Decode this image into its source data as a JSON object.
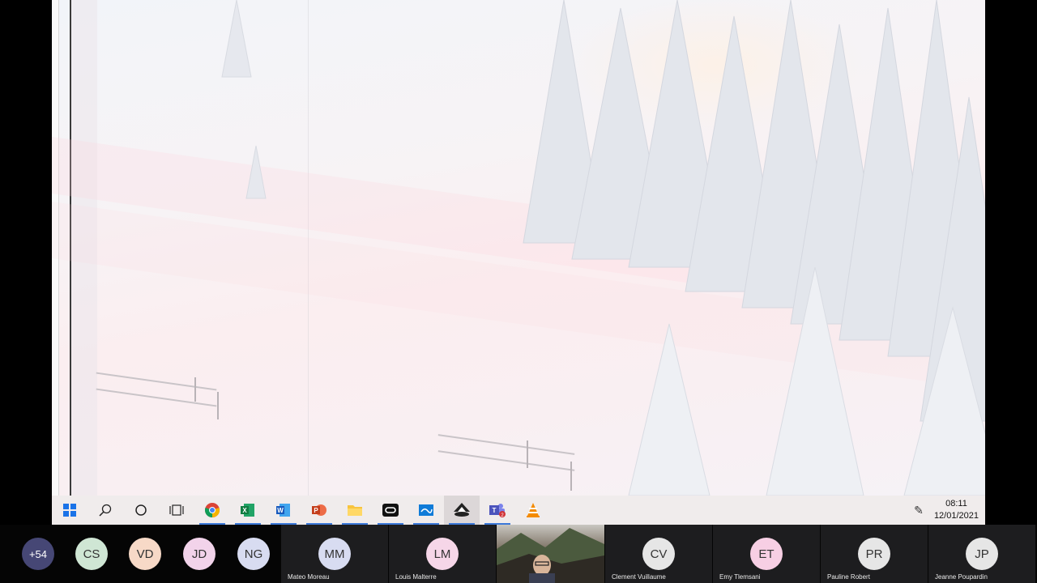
{
  "taskbar": {
    "apps": [
      {
        "name": "start-button",
        "icon": "windows-icon"
      },
      {
        "name": "search-button",
        "icon": "search-icon"
      },
      {
        "name": "cortana-button",
        "icon": "circle-icon"
      },
      {
        "name": "task-view-button",
        "icon": "task-view-icon"
      },
      {
        "name": "chrome-button",
        "icon": "chrome-icon"
      },
      {
        "name": "excel-button",
        "icon": "excel-icon"
      },
      {
        "name": "word-button",
        "icon": "word-icon"
      },
      {
        "name": "powerpoint-button",
        "icon": "powerpoint-icon"
      },
      {
        "name": "file-explorer-button",
        "icon": "folder-icon"
      },
      {
        "name": "oculus-button",
        "icon": "oculus-icon"
      },
      {
        "name": "whiteboard-button",
        "icon": "whiteboard-icon"
      },
      {
        "name": "inkscape-button",
        "icon": "inkscape-icon"
      },
      {
        "name": "teams-button",
        "icon": "teams-icon",
        "badge": "2"
      },
      {
        "name": "vlc-button",
        "icon": "vlc-icon"
      }
    ],
    "time": "08:11",
    "date": "12/01/2021",
    "pen_icon": "pen-icon"
  },
  "participants": {
    "more_count": "+54",
    "avatars": [
      {
        "initials": "CS",
        "color": "#cfe6d4"
      },
      {
        "initials": "VD",
        "color": "#f7d9c7"
      },
      {
        "initials": "JD",
        "color": "#f2d3ea"
      },
      {
        "initials": "NG",
        "color": "#d8dcf1"
      }
    ],
    "named": [
      {
        "initials": "MM",
        "name": "Mateo Moreau",
        "color": "#d8dcf1"
      },
      {
        "initials": "LM",
        "name": "Louis Malterre",
        "color": "#f6d6e8"
      },
      {
        "initials": "CV",
        "name": "Clement Vuillaume",
        "color": "#e6e6e6"
      },
      {
        "initials": "ET",
        "name": "Emy Tlemsani",
        "color": "#f7cfe4"
      },
      {
        "initials": "PR",
        "name": "Pauline Robert",
        "color": "#e6e6e6"
      },
      {
        "initials": "JP",
        "name": "Jeanne Poupardin",
        "color": "#e6e6e6"
      }
    ]
  },
  "colors": {
    "teams_more": "#464775",
    "taskbar_bg": "#f0ecec",
    "active_indicator": "#3b78d8"
  }
}
